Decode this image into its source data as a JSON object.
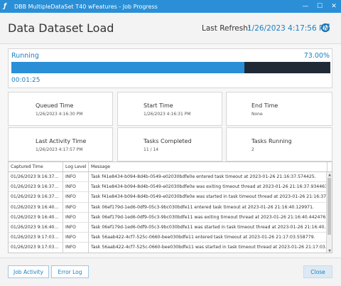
{
  "window": {
    "title": "DBB MultipleDataSet T40 wFeatures - Job Progress",
    "app_icon": "italic-f-icon",
    "controls": [
      "minimize-icon",
      "maximize-icon",
      "close-icon"
    ]
  },
  "header": {
    "title": "Data Dataset Load",
    "refresh_label": "Last Refresh:",
    "refresh_value": "1/26/2023 4:17:56 PM",
    "refresh_icon": "refresh-icon"
  },
  "progress": {
    "status": "Running",
    "percent_text": "73.00%",
    "percent": 0.73,
    "elapsed": "00:01:25",
    "fill_color": "#2a8fd6",
    "track_color": "#1f2a36"
  },
  "cards": [
    {
      "label": "Queued Time",
      "value": "1/26/2023 4:16:30 PM"
    },
    {
      "label": "Start Time",
      "value": "1/26/2023 4:16:31 PM"
    },
    {
      "label": "End Time",
      "value": "None"
    },
    {
      "label": "Last Activity Time",
      "value": "1/26/2023 4:17:57 PM"
    },
    {
      "label": "Tasks Completed",
      "value": "11 / 14"
    },
    {
      "label": "Tasks Running",
      "value": "2"
    }
  ],
  "log": {
    "columns": [
      "Captured Time",
      "Log Level",
      "Message"
    ],
    "rows": [
      [
        "01/26/2023 9:16:37...",
        "INFO",
        "Task f41e8434-b094-8d4b-0549-e02030bdfe0e entered task timeout at 2023-01-26 21:16:37.574425."
      ],
      [
        "01/26/2023 9:16:37...",
        "INFO",
        "Task f41e8434-b094-8d4b-0549-e02030bdfe0e was exiting timeout thread at 2023-01-26 21:16:37.934461."
      ],
      [
        "01/26/2023 9:16:37...",
        "INFO",
        "Task f41e8434-b094-8d4b-0549-e02030bdfe0e was started in task timeout thread at 2023-01-26 21:16:37."
      ],
      [
        "01/26/2023 9:16:40...",
        "INFO",
        "Task 06ef179d-1ed6-0df9-05c3-9bc030bdfe11 entered task timeout at 2023-01-26 21:16:40.129971."
      ],
      [
        "01/26/2023 9:16:40...",
        "INFO",
        "Task 06ef179d-1ed6-0df9-05c3-9bc030bdfe11 was exiting timeout thread at 2023-01-26 21:16:40.442476."
      ],
      [
        "01/26/2023 9:16:40...",
        "INFO",
        "Task 06ef179d-1ed6-0df9-05c3-9bc030bdfe11 was started in task timeout thread at 2023-01-26 21:16:40."
      ],
      [
        "01/26/2023 9:17:03...",
        "INFO",
        "Task 56aab422-4cf7-525c-0660-bee030bdfe11 entered task timeout at 2023-01-26 21:17:03.558779."
      ],
      [
        "01/26/2023 9:17:03...",
        "INFO",
        "Task 56aab422-4cf7-525c-0660-bee030bdfe11 was started in task timeout thread at 2023-01-26 21:17:03."
      ]
    ]
  },
  "footer": {
    "job_activity": "Job Activity",
    "error_log": "Error Log",
    "close": "Close"
  }
}
